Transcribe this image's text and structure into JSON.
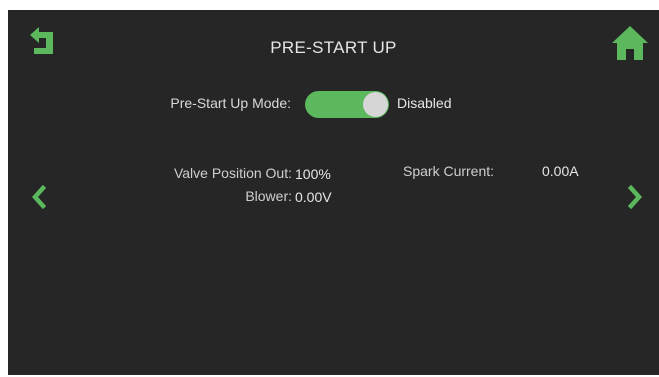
{
  "header": {
    "title": "PRE-START UP",
    "back_icon": "back-arrow-icon",
    "home_icon": "home-icon"
  },
  "mode": {
    "label": "Pre-Start Up Mode:",
    "state": "Disabled"
  },
  "readings": {
    "valve_label": "Valve Position Out:",
    "valve_value": "100%",
    "blower_label": "Blower:",
    "blower_value": "0.00V",
    "spark_label": "Spark Current:",
    "spark_value": "0.00A"
  },
  "nav": {
    "prev_icon": "chevron-left-icon",
    "next_icon": "chevron-right-icon"
  },
  "colors": {
    "accent": "#5cb85c",
    "background": "#262626",
    "text": "#e6e6e6"
  }
}
